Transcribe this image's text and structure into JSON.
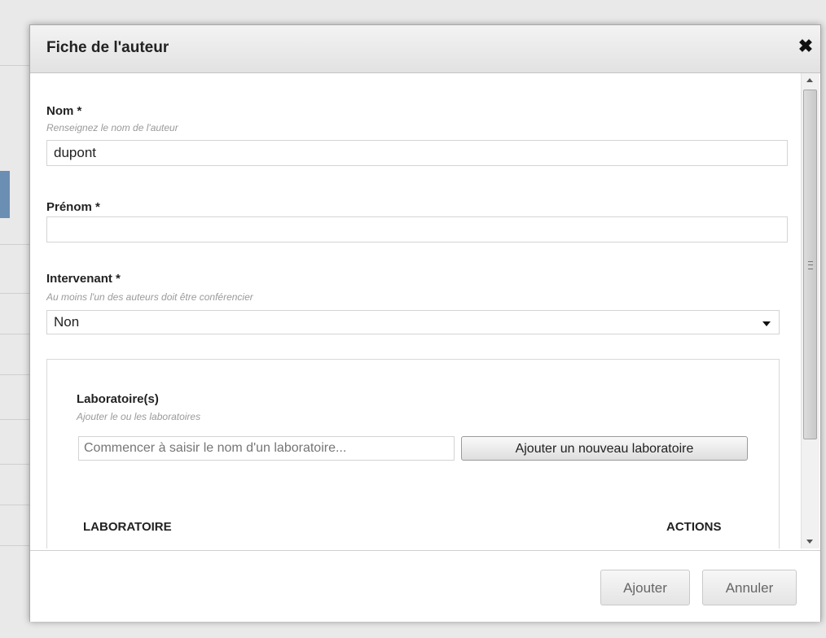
{
  "dialog": {
    "title": "Fiche de l'auteur",
    "close_glyph": "✖"
  },
  "form": {
    "nom": {
      "label": "Nom *",
      "hint": "Renseignez le nom de l'auteur",
      "value": "dupont"
    },
    "prenom": {
      "label": "Prénom *",
      "value": ""
    },
    "intervenant": {
      "label": "Intervenant *",
      "hint": "Au moins l'un des auteurs doit être conférencier",
      "selected": "Non"
    },
    "laboratoires": {
      "label": "Laboratoire(s)",
      "hint": "Ajouter le ou les laboratoires",
      "search_placeholder": "Commencer à saisir le nom d'un laboratoire...",
      "add_button": "Ajouter un nouveau laboratoire",
      "table_headers": {
        "laboratoire": "LABORATOIRE",
        "actions": "ACTIONS"
      }
    }
  },
  "footer": {
    "ajouter": "Ajouter",
    "annuler": "Annuler"
  },
  "icons": {
    "close": "close-icon",
    "dropdown": "chevron-down-icon",
    "scroll_up": "arrow-up-icon",
    "scroll_down": "arrow-down-icon"
  }
}
